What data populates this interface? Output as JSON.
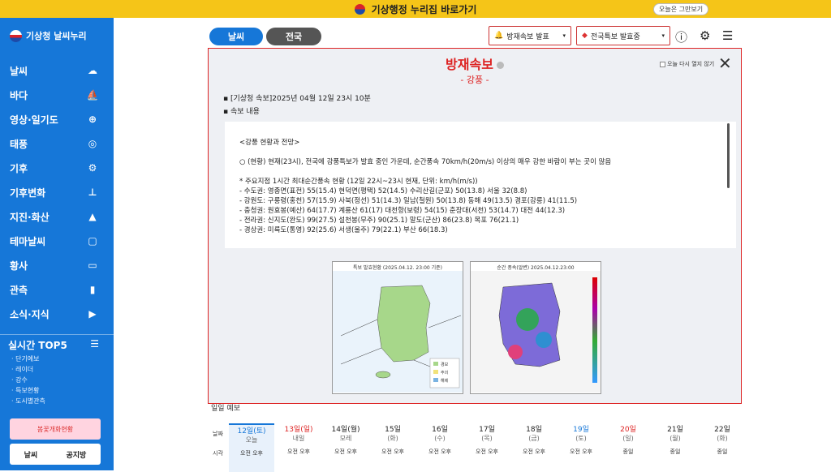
{
  "banner": {
    "text": "기상행정 누리집 바로가기",
    "button": "오늘은 그만보기"
  },
  "logo": {
    "text": "기상청 날씨누리"
  },
  "menu": [
    {
      "label": "날씨",
      "icon": "☁"
    },
    {
      "label": "바다",
      "icon": "⛵"
    },
    {
      "label": "영상·일기도",
      "icon": "⊕"
    },
    {
      "label": "태풍",
      "icon": "◎"
    },
    {
      "label": "기후",
      "icon": "⚙"
    },
    {
      "label": "기후변화",
      "icon": "⊥"
    },
    {
      "label": "지진·화산",
      "icon": "▲"
    },
    {
      "label": "테마날씨",
      "icon": "▢"
    },
    {
      "label": "황사",
      "icon": "▭"
    },
    {
      "label": "관측",
      "icon": "▮"
    },
    {
      "label": "소식·지식",
      "icon": "▶"
    }
  ],
  "top5": {
    "title": "실시간 TOP5",
    "items": [
      "· 단기예보",
      "· 레이더",
      "· 강수",
      "· 특보현황",
      "· 도시별관측"
    ]
  },
  "banners": {
    "b1": "봄꽃개화현황",
    "b2_left": "날씨",
    "b2_right": "공지방"
  },
  "tabs": {
    "t1": "날씨",
    "t2": "전국"
  },
  "buttons": {
    "b1": "방재속보 발표",
    "b2": "전국특보 발효중"
  },
  "modal": {
    "title": "방재속보",
    "subtitle": "- 강풍 -",
    "noshow": "오늘 다시 열지 않기",
    "line1": "▪ [기상청 속보]2025년 04월 12일 23시 10분",
    "line2": "▪ 속보 내용",
    "content": [
      "<강풍 현황과 전망>",
      "",
      "○ (현황) 현재(23시), 전국에 강풍특보가 발효 중인 가운데, 순간풍속 70km/h(20m/s) 이상의 매우 강한 바람이 부는 곳이 많음",
      "",
      "* 주요지점 1시간 최대순간풍속 현황 (12일 22시~23시 현재, 단위: km/h(m/s))",
      "- 수도권: 영종면(표전) 55(15.4) 현덕면(평택) 52(14.5) 수리산길(군포) 50(13.8) 서울 32(8.8)",
      "- 강원도: 구룡령(홍천) 57(15.9) 사북(정선) 51(14.3) 일남(철원) 50(13.8) 동해 49(13.5) 경포(강릉) 41(11.5)",
      "- 충청권: 원효봉(예산) 64(17.7) 계룡산 61(17) 대천항(보령) 54(15) 춘장대(서천) 53(14.7) 대전 44(12.3)",
      "- 전라권: 신지도(완도) 99(27.5) 설천봉(무주) 90(25.1) 말도(군산) 86(23.8) 목포 76(21.1)",
      "- 경상권: 미륵도(통영) 92(25.6) 서생(울주) 79(22.1) 부산 66(18.3)"
    ],
    "map1_title": "특보 발효현황 (2025.04.12. 23:00 기준)",
    "map2_title": "순간 풍속(알변)   2025.04.12.23:00",
    "legend": [
      "경보",
      "주의",
      "해제"
    ]
  },
  "forecast": {
    "header": "일일 예보",
    "row_labels": [
      "날짜",
      "시각"
    ],
    "days": [
      {
        "d": "12일(토)",
        "s": "오늘",
        "c": "sat"
      },
      {
        "d": "13일(일)",
        "s": "내일",
        "c": "sun"
      },
      {
        "d": "14일(월)",
        "s": "모레",
        "c": ""
      },
      {
        "d": "15일",
        "s": "(화)",
        "c": ""
      },
      {
        "d": "16일",
        "s": "(수)",
        "c": ""
      },
      {
        "d": "17일",
        "s": "(목)",
        "c": ""
      },
      {
        "d": "18일",
        "s": "(금)",
        "c": ""
      },
      {
        "d": "19일",
        "s": "(토)",
        "c": "sat"
      },
      {
        "d": "20일",
        "s": "(일)",
        "c": "sun"
      },
      {
        "d": "21일",
        "s": "(월)",
        "c": ""
      },
      {
        "d": "22일",
        "s": "(화)",
        "c": ""
      }
    ],
    "times": [
      "오전 오후",
      "오전 오후",
      "오전 오후",
      "오전 오후",
      "오전 오후",
      "오전 오후",
      "오전 오후",
      "오전 오후",
      "종일",
      "종일",
      "종일"
    ]
  }
}
